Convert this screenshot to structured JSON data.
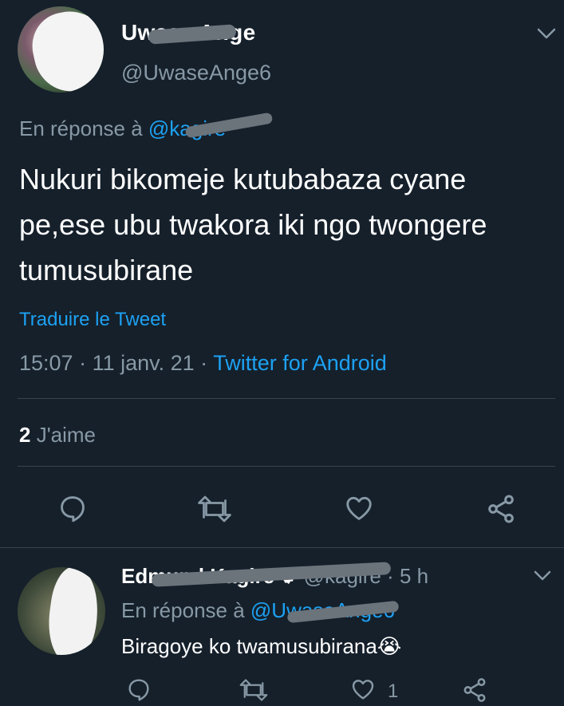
{
  "main_tweet": {
    "display_name": "Uwase Ange",
    "handle": "@UwaseAnge6",
    "reply_prefix": "En réponse à",
    "reply_to": "@kagire",
    "text": "Nukuri bikomeje kutubabaza cyane pe,ese ubu twakora iki ngo twongere tumusubirane",
    "translate": "Traduire le Tweet",
    "time": "15:07",
    "sep1": " · ",
    "date": "11 janv. 21",
    "sep2": " · ",
    "source": "Twitter for Android",
    "likes_count": "2",
    "likes_label": " J'aime"
  },
  "reply_tweet": {
    "display_name": "Edmund Kagire",
    "handle": "@kagire",
    "sep": " · ",
    "age": "5 h",
    "reply_prefix": "En réponse à",
    "reply_to": "@UwaseAnge6",
    "text": "Biragoye ko twamusubirana😭",
    "like_count": "1"
  },
  "icons": [
    "chevron-down-icon",
    "reply-icon",
    "retweet-icon",
    "like-icon",
    "share-icon",
    "verified-icon"
  ],
  "colors": {
    "background": "#15202b",
    "accent": "#1da1f2",
    "muted": "#8899a6",
    "divider": "#38444d"
  }
}
